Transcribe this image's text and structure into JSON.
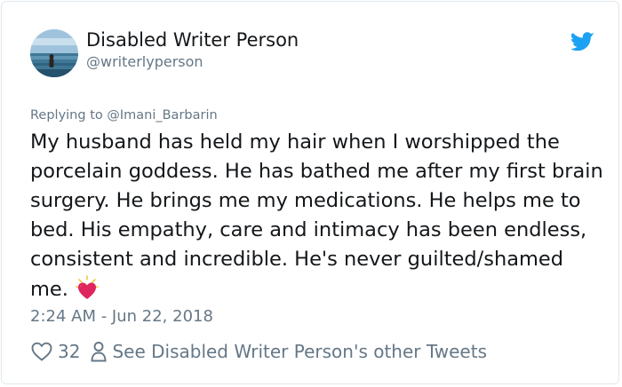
{
  "user": {
    "display_name": "Disabled Writer Person",
    "handle": "@writerlyperson",
    "avatar_icon": "profile-photo-ocean"
  },
  "reply": {
    "text": "Replying to @Imani_Barbarin"
  },
  "tweet": {
    "text": "My husband has held my hair when I worshipped the porcelain goddess. He has bathed me after my first brain surgery. He brings me my medications. He helps me to bed. His empathy, care and intimacy has been endless, consistent and incredible. He's never guilted/shamed me.",
    "emoji": "beating-heart-emoji",
    "timestamp": "2:24 AM - Jun 22, 2018"
  },
  "actions": {
    "like_count": "32",
    "other_tweets_label": "See Disabled Writer Person's other Tweets"
  },
  "colors": {
    "text": "#14171a",
    "muted": "#657786",
    "twitter_blue": "#1da1f2",
    "heart": "#e0245e"
  }
}
